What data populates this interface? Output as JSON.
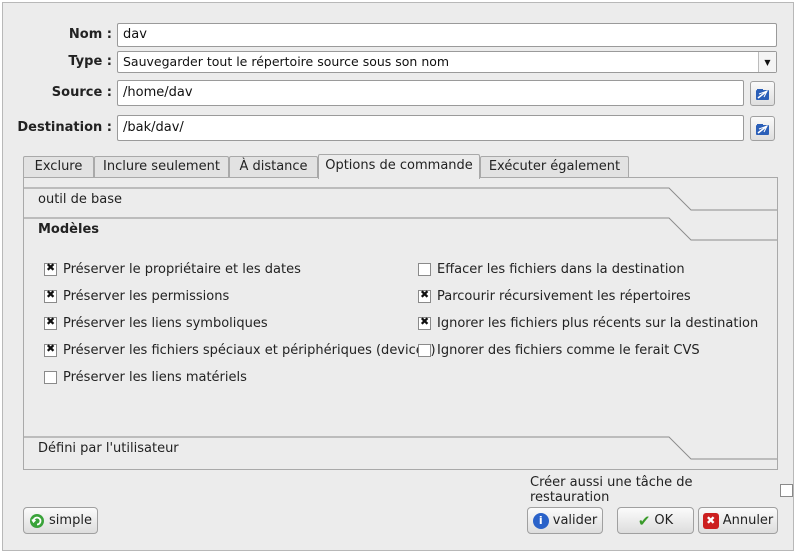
{
  "form": {
    "name_label": "Nom :",
    "name_value": "dav",
    "type_label": "Type :",
    "type_value": "Sauvegarder tout le répertoire source sous son nom",
    "source_label": "Source :",
    "source_value": "/home/dav",
    "destination_label": "Destination :",
    "destination_value": "/bak/dav/"
  },
  "tabs": [
    {
      "label": "Exclure"
    },
    {
      "label": "Inclure seulement"
    },
    {
      "label": "À distance"
    },
    {
      "label": "Options de commande",
      "active": true
    },
    {
      "label": "Exécuter également"
    }
  ],
  "panel": {
    "base_tool_label": "outil de base",
    "models_label": "Modèles",
    "user_defined_label": "Défini par l'utilisateur",
    "left_options": [
      {
        "label": "Préserver le propriétaire et les dates",
        "checked": true
      },
      {
        "label": "Préserver les permissions",
        "checked": true
      },
      {
        "label": "Préserver les liens symboliques",
        "checked": true
      },
      {
        "label": "Préserver les fichiers spéciaux et périphériques (devices)",
        "checked": true
      },
      {
        "label": "Préserver les liens matériels",
        "checked": false
      }
    ],
    "right_options": [
      {
        "label": "Effacer les fichiers dans la destination",
        "checked": false
      },
      {
        "label": "Parcourir récursivement les répertoires",
        "checked": true
      },
      {
        "label": "Ignorer les fichiers plus récents sur la destination",
        "checked": true
      },
      {
        "label": "Ignorer des fichiers comme le ferait CVS",
        "checked": false
      }
    ]
  },
  "footer": {
    "restore_task_label": "Créer aussi une tâche de restauration",
    "restore_task_checked": false,
    "simple_label": "simple",
    "validate_label": "valider",
    "ok_label": "OK",
    "cancel_label": "Annuler"
  },
  "colors": {
    "window_bg": "#ececec",
    "ok_check": "#3a9b2a",
    "cancel_x": "#cc1f1f",
    "info_blue": "#2a62c9",
    "simple_green": "#3aa33a"
  }
}
